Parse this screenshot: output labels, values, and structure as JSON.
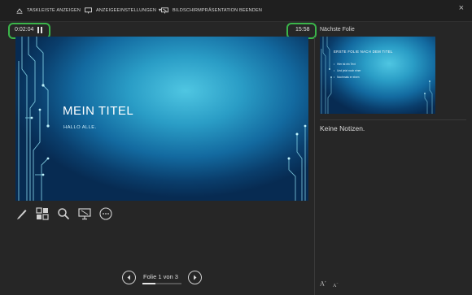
{
  "toolbar": {
    "show_taskbar": "TASKLEISTE ANZEIGEN",
    "display_settings": "ANZEIGEEINSTELLUNGEN ▼",
    "end_show": "BILDSCHIRMPRÄSENTATION BEENDEN",
    "close_glyph": "×"
  },
  "timer": {
    "elapsed": "0:02:04"
  },
  "clock": {
    "time": "15:58"
  },
  "current_slide": {
    "title": "MEIN TITEL",
    "subtitle": "HALLO ALLE."
  },
  "navigation": {
    "counter": "Folie 1 von 3",
    "progress_fraction": 0.33
  },
  "next_slide": {
    "label": "Nächste Folie",
    "title": "ERSTE FOLIE NACH DEM TITEL",
    "bullets": [
      "Hier ist ein Text",
      "Und jetzt noch einer",
      "Nochmals er einen"
    ]
  },
  "notes": {
    "text": "Keine Notizen."
  },
  "font_controls": {
    "increase": "A",
    "decrease": "A"
  },
  "colors": {
    "accent_highlight": "#3bb54a",
    "slide_blue": "#1a8ab8"
  },
  "icons": [
    "taskbar-icon",
    "display-settings-icon",
    "end-show-icon",
    "pause-icon",
    "pen-icon",
    "slide-grid-icon",
    "zoom-icon",
    "screen-icon",
    "more-options-icon",
    "prev-arrow-icon",
    "next-arrow-icon"
  ]
}
